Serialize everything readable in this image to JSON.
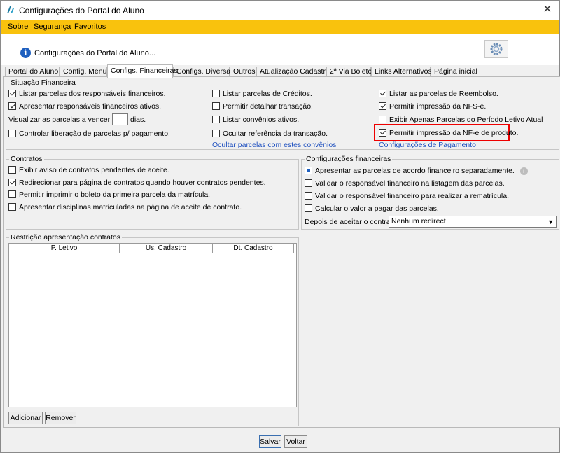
{
  "window": {
    "title": "Configurações do Portal do Aluno",
    "close_glyph": "✕"
  },
  "menu": {
    "items": [
      "Sobre",
      "Segurança",
      "Favoritos"
    ]
  },
  "header": {
    "title": "Configurações do Portal do Aluno...",
    "info_glyph": "i"
  },
  "tabs": [
    "Portal do Aluno",
    "Config. Menu",
    "Configs. Financeiras",
    "Configs. Diversas",
    "Outros",
    "Atualização Cadastral",
    "2ª Via Boleto",
    "Links Alternativos",
    "Página inicial"
  ],
  "active_tab": "Configs. Financeiras",
  "situacao": {
    "title": "Situação Financeira",
    "col1": [
      {
        "label": "Listar parcelas dos responsáveis financeiros.",
        "checked": true
      },
      {
        "label": "Apresentar responsáveis financeiros ativos.",
        "checked": true
      },
      {
        "label": "Controlar liberação de parcelas p/ pagamento.",
        "checked": false
      }
    ],
    "visualizar_label": "Visualizar as parcelas a vencer com",
    "visualizar_value": "",
    "dias_label": "dias.",
    "col2": [
      {
        "label": "Listar parcelas de Créditos.",
        "checked": false
      },
      {
        "label": "Permitir detalhar transação.",
        "checked": false
      },
      {
        "label": "Listar convênios ativos.",
        "checked": false
      },
      {
        "label": "Ocultar referência da transação.",
        "checked": false
      }
    ],
    "link_convenios": "Ocultar parcelas com estes convênios",
    "col3": [
      {
        "label": "Listar as parcelas de Reembolso.",
        "checked": true
      },
      {
        "label": "Permitir impressão da NFS-e.",
        "checked": true
      },
      {
        "label": "Exibir Apenas Parcelas do Período Letivo Atual",
        "checked": false
      },
      {
        "label": "Permitir impressão da NF-e de produto.",
        "checked": true
      }
    ],
    "link_pagamento": "Configurações de Pagamento"
  },
  "contratos": {
    "title": "Contratos",
    "items": [
      {
        "label": "Exibir aviso de contratos pendentes de aceite.",
        "checked": false
      },
      {
        "label": "Redirecionar para página de contratos quando houver contratos pendentes.",
        "checked": true
      },
      {
        "label": "Permitir imprimir o boleto da primeira parcela da matrícula.",
        "checked": false
      },
      {
        "label": "Apresentar disciplinas matriculadas na página de aceite de contrato.",
        "checked": false
      }
    ]
  },
  "config_fin": {
    "title": "Configurações financeiras",
    "items": [
      {
        "label": "Apresentar as parcelas de acordo financeiro separadamente.",
        "checked": true
      },
      {
        "label": "Validar o responsável financeiro na listagem das parcelas.",
        "checked": false
      },
      {
        "label": "Validar o responsável financeiro para realizar a rematrícula.",
        "checked": false
      },
      {
        "label": "Calcular o valor a pagar das parcelas.",
        "checked": false
      }
    ],
    "depois_label": "Depois de aceitar o contrato:",
    "depois_value": "Nenhum redirect"
  },
  "restricao": {
    "title": "Restrição apresentação contratos",
    "columns": [
      "P. Letivo",
      "Us. Cadastro",
      "Dt. Cadastro"
    ],
    "add_label": "Adicionar",
    "remove_label": "Remover"
  },
  "footer": {
    "save_label": "Salvar",
    "back_label": "Voltar"
  },
  "colors": {
    "menubar": "#f9c20d",
    "link": "#1d4fbf",
    "highlight": "#e00000"
  }
}
